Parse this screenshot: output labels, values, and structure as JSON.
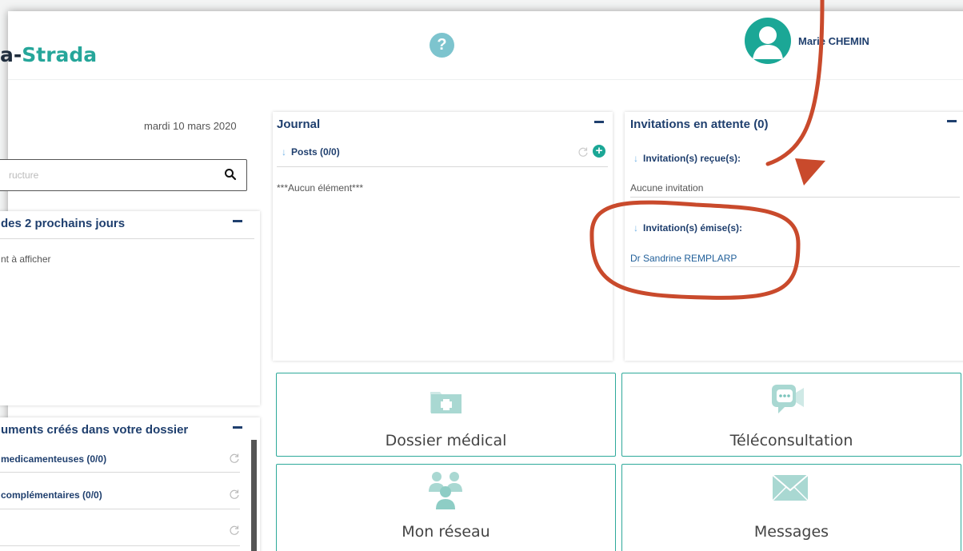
{
  "header": {
    "logo_prefix": "a-",
    "logo_accent": "Strada",
    "help_icon": "question-circle-icon",
    "help_glyph": "?",
    "user_name": "Marie CHEMIN",
    "avatar_icon": "user-avatar-icon"
  },
  "left": {
    "date": "mardi 10 mars 2020",
    "search_placeholder": "ructure",
    "agenda_title": "des 2 prochains jours",
    "agenda_empty": "nt à afficher",
    "docs_title": "uments créés dans votre dossier",
    "docs_items": [
      {
        "label": "medicamenteuses (0/0)"
      },
      {
        "label": "complémentaires (0/0)"
      },
      {
        "label": ""
      }
    ]
  },
  "journal": {
    "title": "Journal",
    "posts_label": "Posts (0/0)",
    "empty": "***Aucun élément***"
  },
  "invitations": {
    "title": "Invitations en attente (0)",
    "received_label": "Invitation(s) reçue(s):",
    "received_empty": "Aucune invitation",
    "sent_label": "Invitation(s) émise(s):",
    "sent_items": [
      "Dr Sandrine REMPLARP"
    ]
  },
  "tiles": [
    {
      "label": "Dossier médical",
      "icon": "medical-folder-icon"
    },
    {
      "label": "Téléconsultation",
      "icon": "video-chat-icon"
    },
    {
      "label": "Mon réseau",
      "icon": "people-network-icon"
    },
    {
      "label": "Messages",
      "icon": "envelope-icon"
    }
  ],
  "colors": {
    "brand_teal": "#26a69a",
    "navy": "#1f3f6e",
    "tile_border": "#2ea99a",
    "annotation_red": "#c94a2c"
  }
}
